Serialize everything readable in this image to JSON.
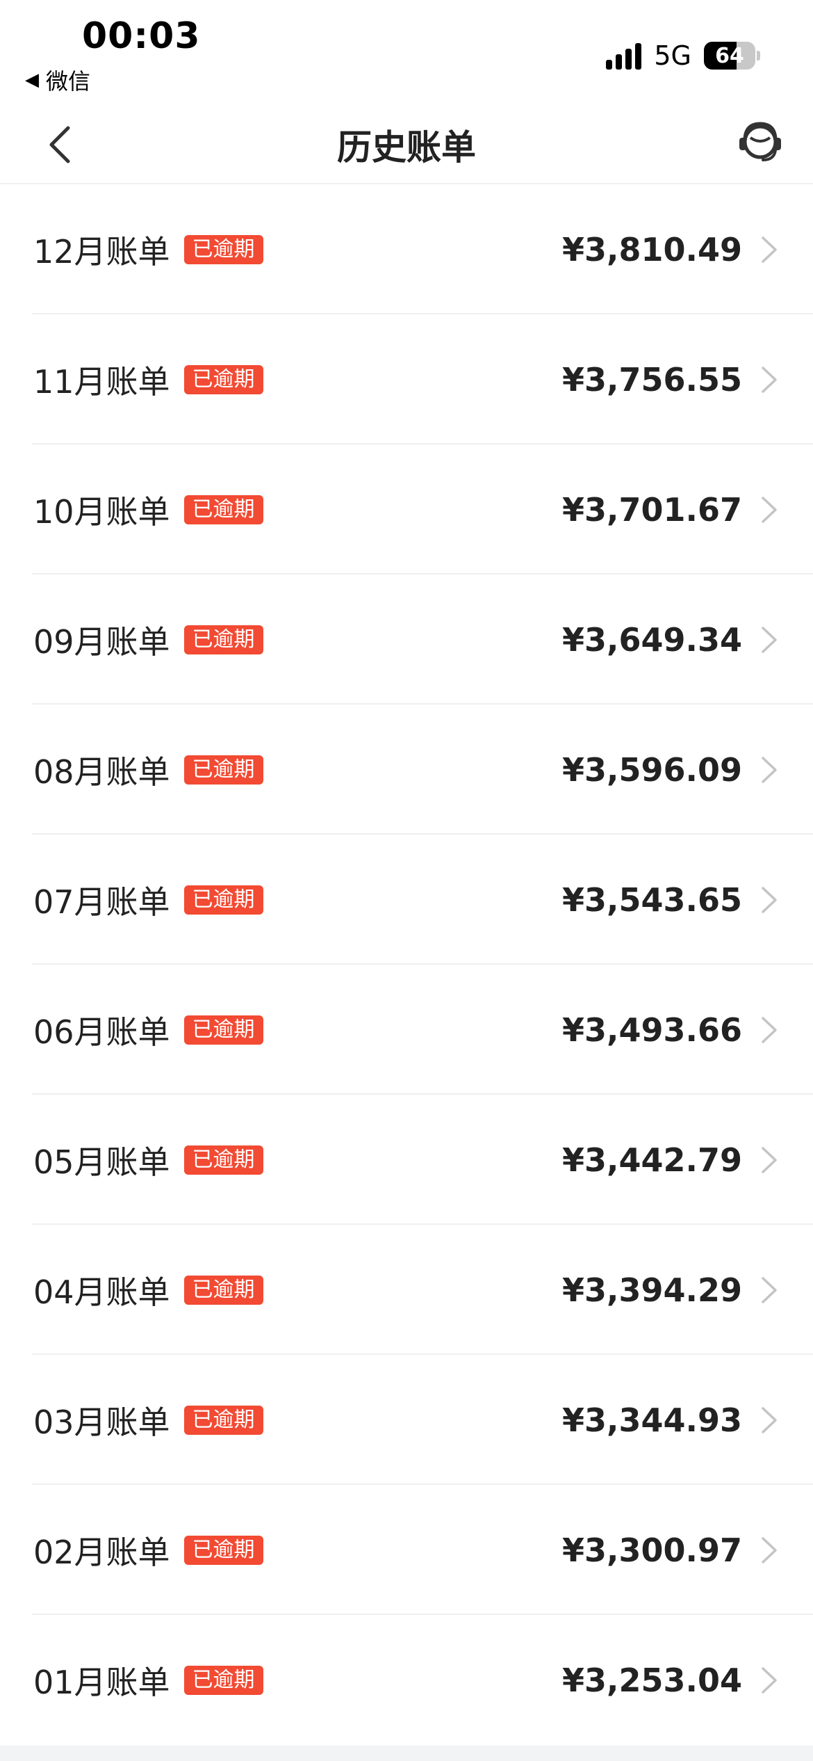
{
  "status_bar": {
    "time": "00:03",
    "back_app": "微信",
    "network": "5G",
    "battery": "64",
    "battery_level": 0.64
  },
  "nav": {
    "title": "历史账单",
    "back_icon": "chevron-left-icon",
    "service_icon": "customer-service-icon"
  },
  "badge_color": "#f24a33",
  "bills": [
    {
      "month": "12月账单",
      "badge": "已逾期",
      "amount": "¥3,810.49"
    },
    {
      "month": "11月账单",
      "badge": "已逾期",
      "amount": "¥3,756.55"
    },
    {
      "month": "10月账单",
      "badge": "已逾期",
      "amount": "¥3,701.67"
    },
    {
      "month": "09月账单",
      "badge": "已逾期",
      "amount": "¥3,649.34"
    },
    {
      "month": "08月账单",
      "badge": "已逾期",
      "amount": "¥3,596.09"
    },
    {
      "month": "07月账单",
      "badge": "已逾期",
      "amount": "¥3,543.65"
    },
    {
      "month": "06月账单",
      "badge": "已逾期",
      "amount": "¥3,493.66"
    },
    {
      "month": "05月账单",
      "badge": "已逾期",
      "amount": "¥3,442.79"
    },
    {
      "month": "04月账单",
      "badge": "已逾期",
      "amount": "¥3,394.29"
    },
    {
      "month": "03月账单",
      "badge": "已逾期",
      "amount": "¥3,344.93"
    },
    {
      "month": "02月账单",
      "badge": "已逾期",
      "amount": "¥3,300.97"
    },
    {
      "month": "01月账单",
      "badge": "已逾期",
      "amount": "¥3,253.04"
    }
  ]
}
